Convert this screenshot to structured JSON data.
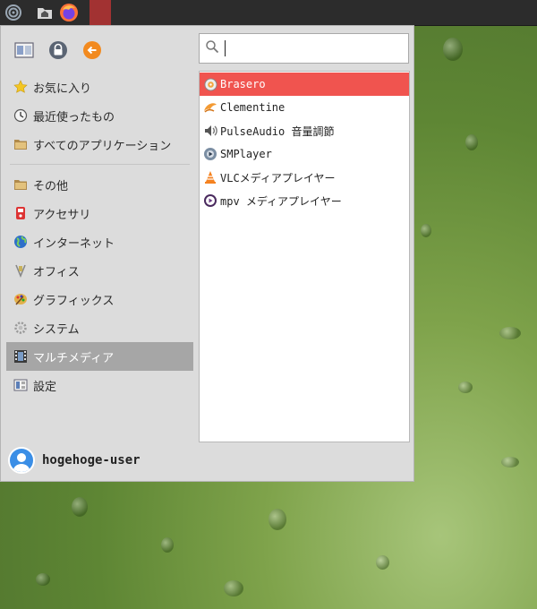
{
  "taskbar": {
    "items": [
      {
        "icon": "spiral-menu-icon"
      },
      {
        "icon": "home-folder-icon"
      },
      {
        "icon": "firefox-icon"
      },
      {
        "icon": "active-window-indicator"
      }
    ]
  },
  "menu": {
    "top_icons": [
      "switch-user-icon",
      "lock-icon",
      "logout-arrow-icon"
    ],
    "categories_top": [
      {
        "label": "お気に入り",
        "icon": "star-icon"
      },
      {
        "label": "最近使ったもの",
        "icon": "clock-icon"
      },
      {
        "label": "すべてのアプリケーション",
        "icon": "folder-icon"
      }
    ],
    "categories": [
      {
        "label": "その他",
        "icon": "folder-icon"
      },
      {
        "label": "アクセサリ",
        "icon": "accessories-icon"
      },
      {
        "label": "インターネット",
        "icon": "globe-icon"
      },
      {
        "label": "オフィス",
        "icon": "office-icon"
      },
      {
        "label": "グラフィックス",
        "icon": "graphics-icon"
      },
      {
        "label": "システム",
        "icon": "gear-icon"
      },
      {
        "label": "マルチメディア",
        "icon": "multimedia-icon",
        "active": true
      },
      {
        "label": "設定",
        "icon": "settings-icon"
      }
    ],
    "search": {
      "placeholder": ""
    },
    "apps": [
      {
        "label": "Brasero",
        "icon": "brasero-icon",
        "selected": true
      },
      {
        "label": "Clementine",
        "icon": "clementine-icon"
      },
      {
        "label": "PulseAudio 音量調節",
        "icon": "speaker-icon"
      },
      {
        "label": "SMPlayer",
        "icon": "smplayer-icon"
      },
      {
        "label": "VLCメディアプレイヤー",
        "icon": "vlc-icon"
      },
      {
        "label": "mpv メディアプレイヤー",
        "icon": "mpv-icon"
      }
    ],
    "user": {
      "name": "hogehoge-user"
    }
  },
  "colors": {
    "selected": "#f0544f",
    "active_category": "#a6a6a6",
    "panel": "#dcdcdc",
    "taskbar": "#2c2c2c",
    "avatar": "#3a8ee6"
  }
}
